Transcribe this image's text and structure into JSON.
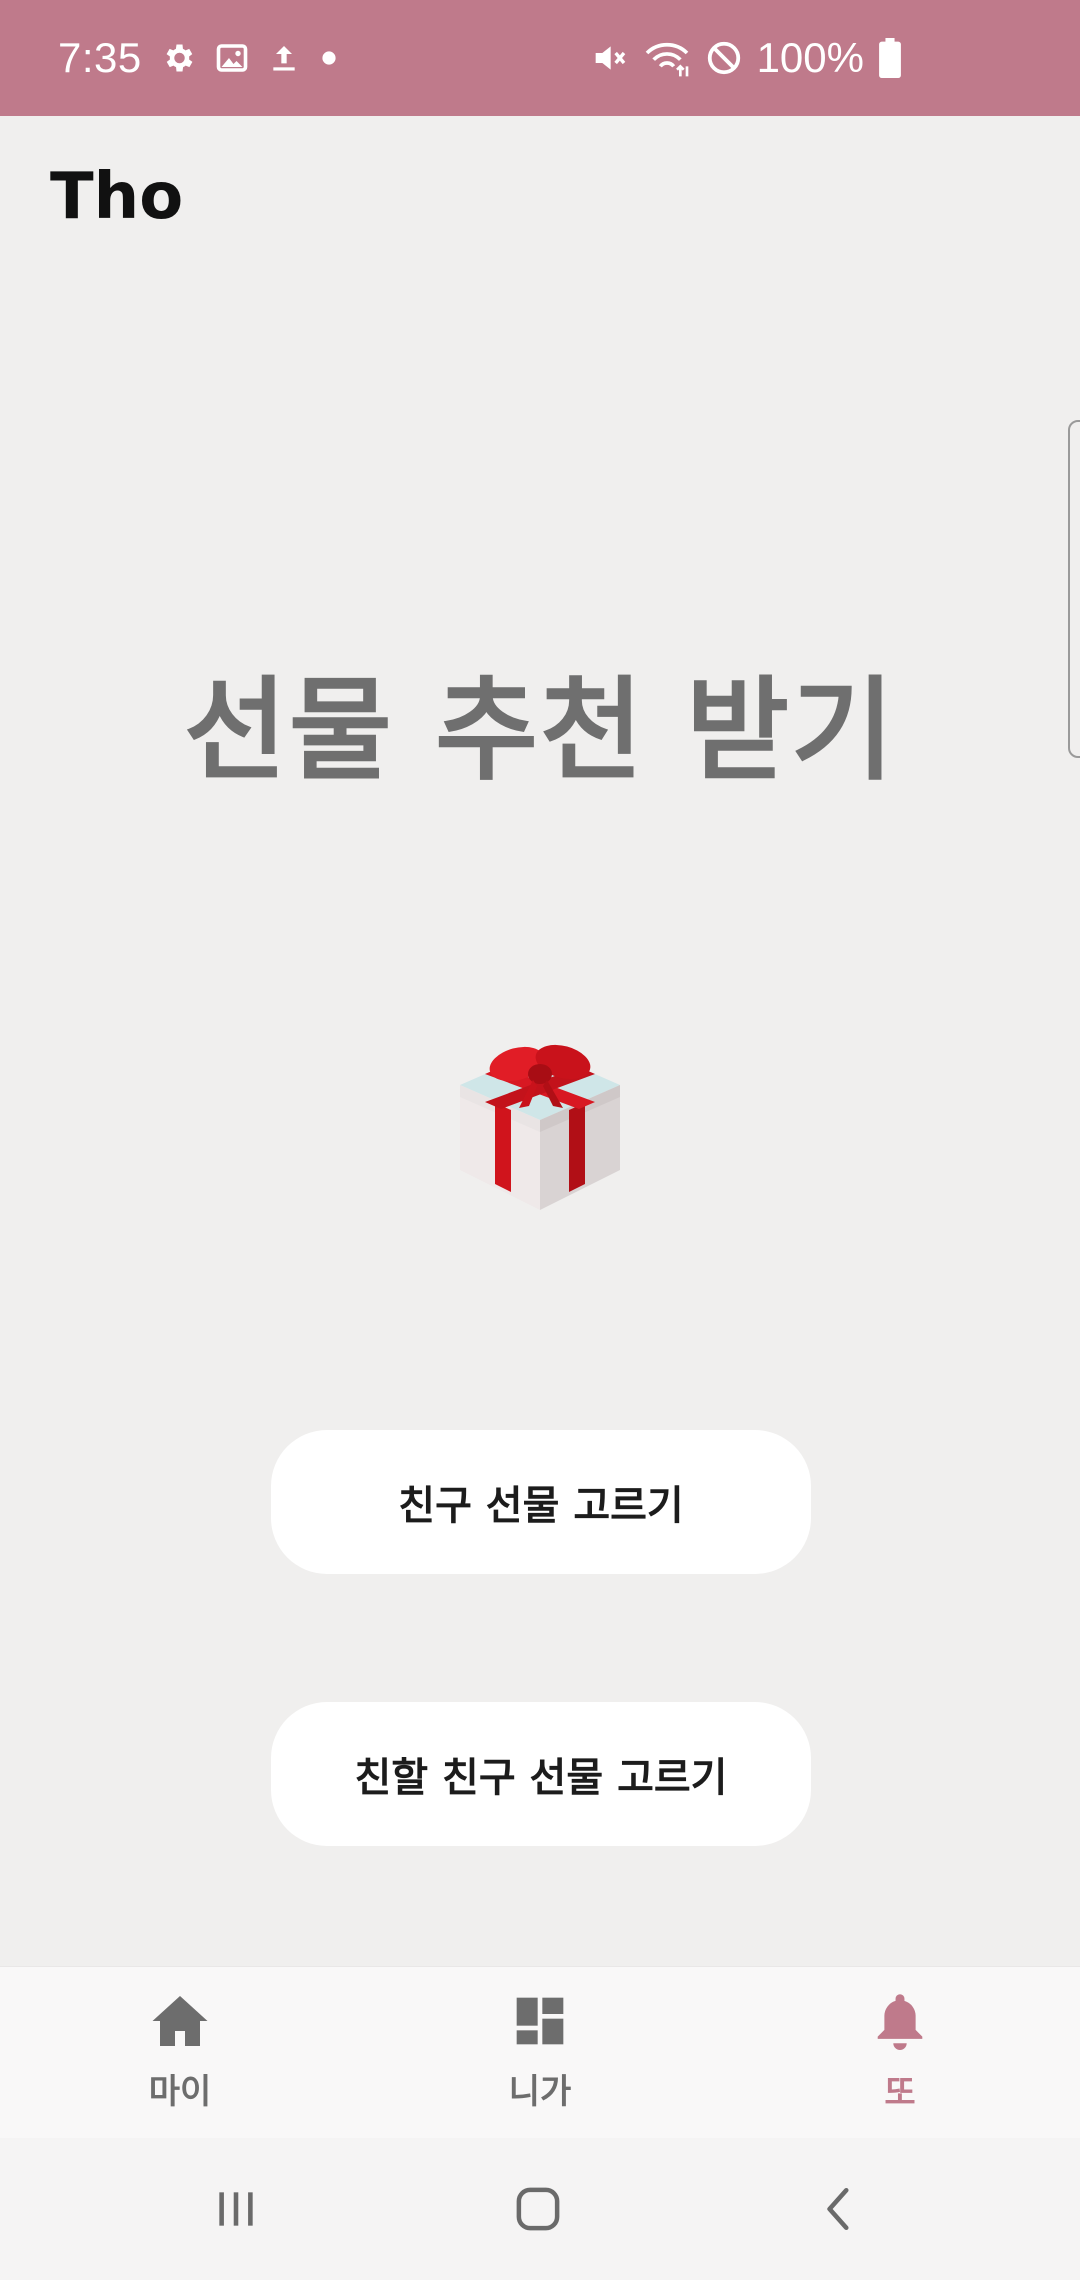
{
  "status_bar": {
    "time": "7:35",
    "battery": "100%",
    "left_icons": [
      "gear-icon",
      "image-icon",
      "upload-icon",
      "dot-icon"
    ],
    "right_icons": [
      "mute-icon",
      "wifi-icon",
      "block-icon",
      "battery-icon"
    ],
    "color": "#bf7a8b"
  },
  "app": {
    "title": "Tho"
  },
  "main": {
    "heading": "선물 추천 받기",
    "image": "gift-box-icon",
    "buttons": [
      {
        "label": "친구 선물 고르기"
      },
      {
        "label": "친할 친구 선물 고르기"
      }
    ]
  },
  "bottom_nav": {
    "items": [
      {
        "label": "마이",
        "icon": "home-icon",
        "active": false
      },
      {
        "label": "니가",
        "icon": "dashboard-icon",
        "active": false
      },
      {
        "label": "또",
        "icon": "bell-icon",
        "active": true
      }
    ],
    "active_color": "#bf7a8b"
  },
  "system_nav": {
    "buttons": [
      "recent-apps-icon",
      "home-button-icon",
      "back-icon"
    ]
  }
}
